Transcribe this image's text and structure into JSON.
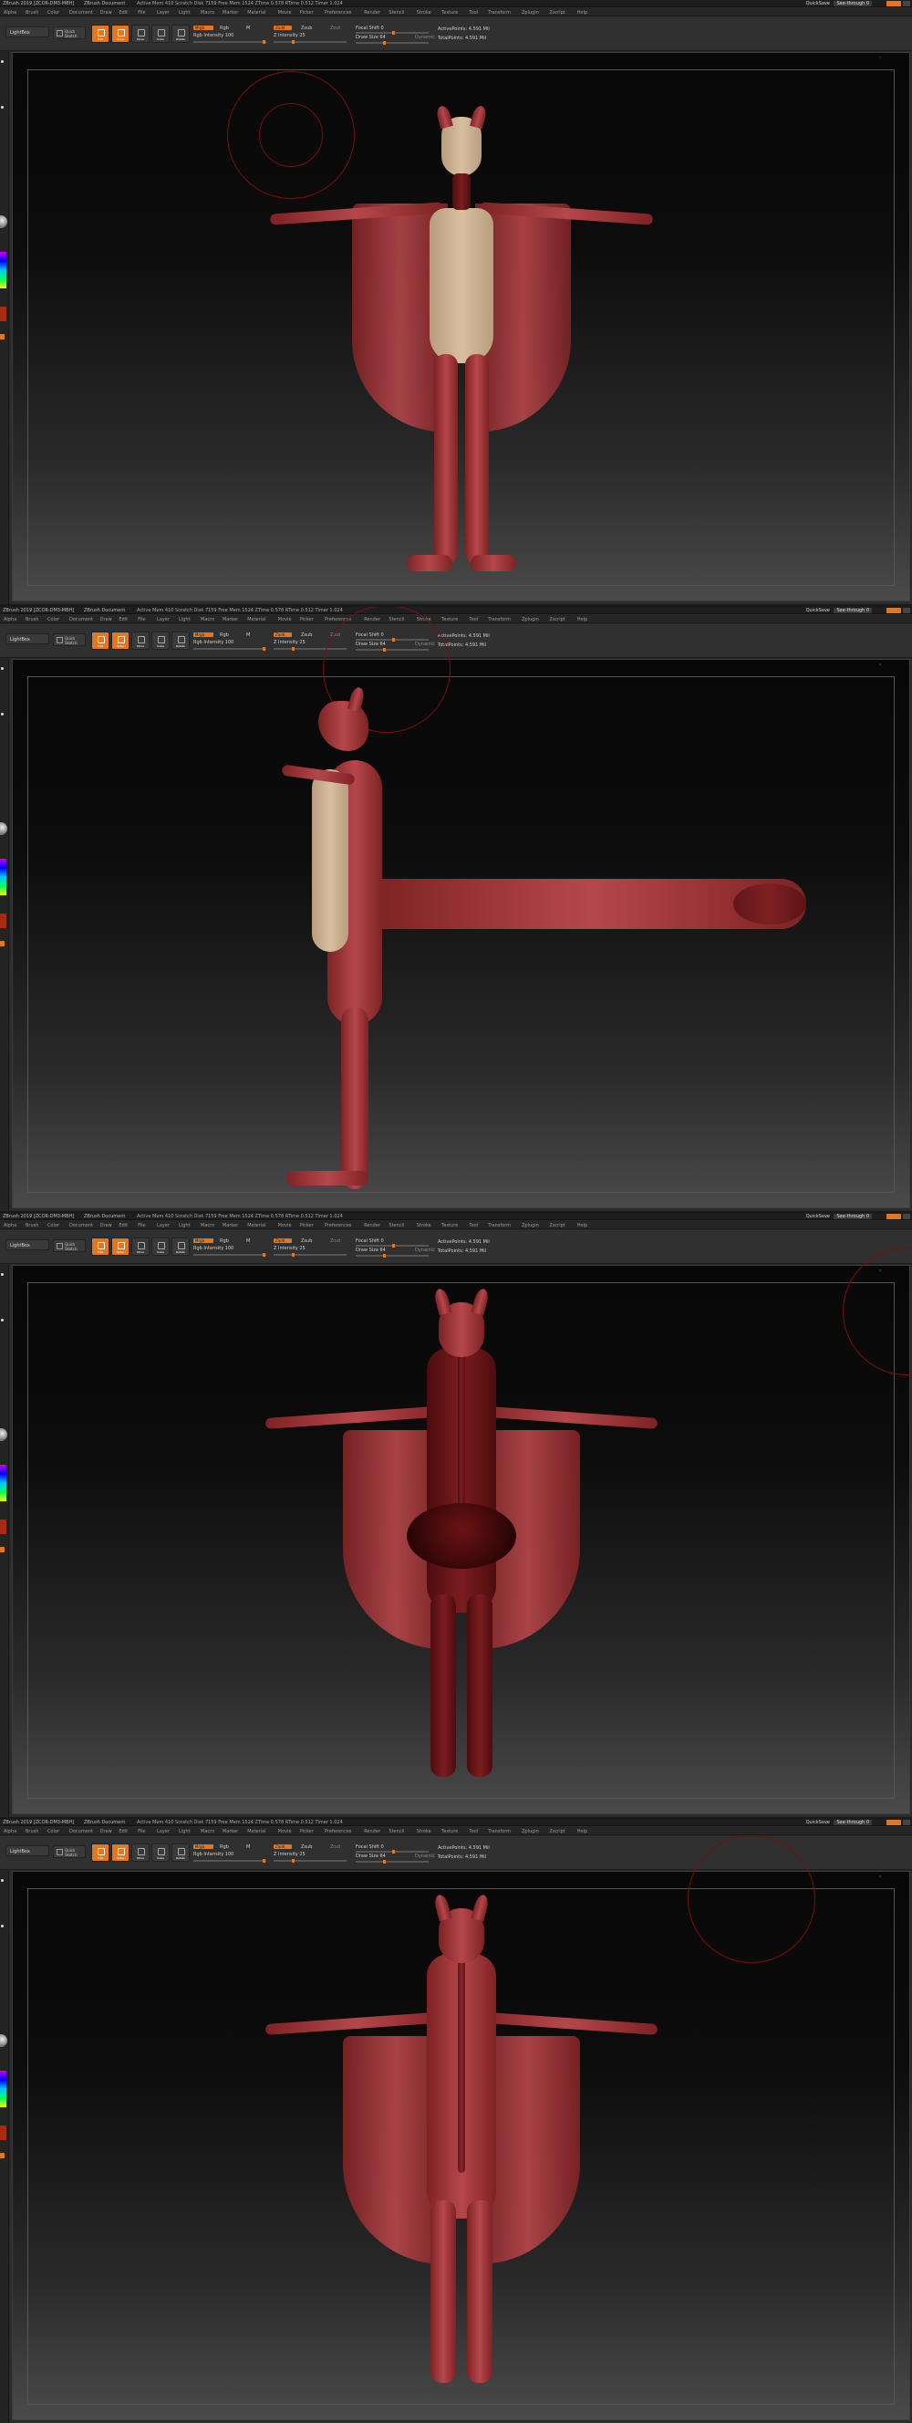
{
  "window": {
    "title": "ZBrush 2019 [ZCOR-DM3-MBH]",
    "document": "ZBrush Document",
    "stats": "Active Mem 410  Scratch Disk 7159  Free Mem 1524  ZTime 0.578  RTime 0.512  Timer 1.024",
    "quicksave": "QuickSave",
    "see_through": "See-through 0",
    "menus": [
      "Alpha",
      "Brush",
      "Color",
      "Document",
      "Draw",
      "Edit",
      "File",
      "Layer",
      "Light",
      "Macro",
      "Marker",
      "Material",
      "Movie",
      "Picker",
      "Preferences",
      "Render",
      "Stencil",
      "Stroke",
      "Texture",
      "Tool",
      "Transform",
      "Zplugin",
      "Zscript",
      "Help"
    ]
  },
  "toolbar": {
    "lightbox": "LightBox",
    "quick_sketch": "Quick Sketch",
    "edit_label": "Edit",
    "draw_label": "Draw",
    "move_label": "Move",
    "scale_label": "Scale",
    "rotate_label": "Rotate",
    "mrgb": "Mrgb",
    "rgb": "Rgb",
    "m": "M",
    "zadd": "Zadd",
    "zsub": "Zsub",
    "zcut": "Zcut",
    "rgb_intensity": "Rgb Intensity 100",
    "z_intensity": "Z Intensity 25",
    "focal_shift": "Focal Shift 0",
    "draw_size": "Draw Size 64",
    "dynamic": "Dynamic",
    "active_points": "ActivePoints: 4.591 Mil",
    "total_points": "TotalPoints: 4.591 Mil"
  },
  "views": [
    {
      "name": "front-view"
    },
    {
      "name": "side-view"
    },
    {
      "name": "back-view-tail"
    },
    {
      "name": "back-view"
    }
  ],
  "colors": {
    "accent": "#e6751b",
    "body_red": "#b5474c",
    "body_skin": "#d7bf9f"
  },
  "icons": [
    "quick-sketch-icon",
    "edit-icon",
    "draw-icon",
    "move-icon",
    "scale-icon",
    "rotate-icon",
    "close-icon"
  ]
}
